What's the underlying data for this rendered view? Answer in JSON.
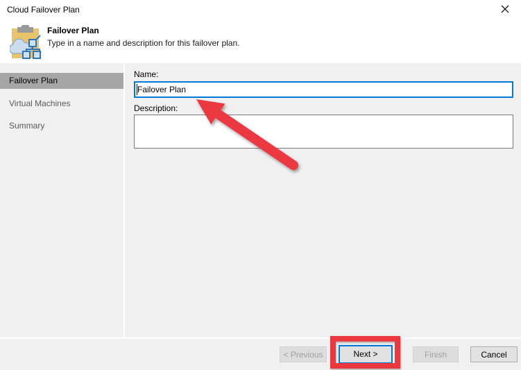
{
  "window": {
    "title": "Cloud Failover Plan",
    "close_icon": "close-icon"
  },
  "header": {
    "title": "Failover Plan",
    "subtitle": "Type in a name and description for this failover plan.",
    "icon": "clipboard-cloud-network-icon"
  },
  "sidebar": {
    "items": [
      {
        "label": "Failover Plan",
        "selected": true
      },
      {
        "label": "Virtual Machines",
        "selected": false
      },
      {
        "label": "Summary",
        "selected": false
      }
    ]
  },
  "form": {
    "name_label": "Name:",
    "name_value": "Failover Plan",
    "description_label": "Description:",
    "description_value": ""
  },
  "footer": {
    "previous_label": "< Previous",
    "next_label": "Next >",
    "finish_label": "Finish",
    "cancel_label": "Cancel"
  },
  "annotations": {
    "arrow": "red arrow pointing at Name field",
    "highlight": "red rectangle around Next button"
  },
  "colors": {
    "accent_blue": "#0078d7",
    "annotation_red": "#ec3940",
    "panel_gray": "#f0f0f0",
    "selected_gray": "#a6a6a6"
  }
}
